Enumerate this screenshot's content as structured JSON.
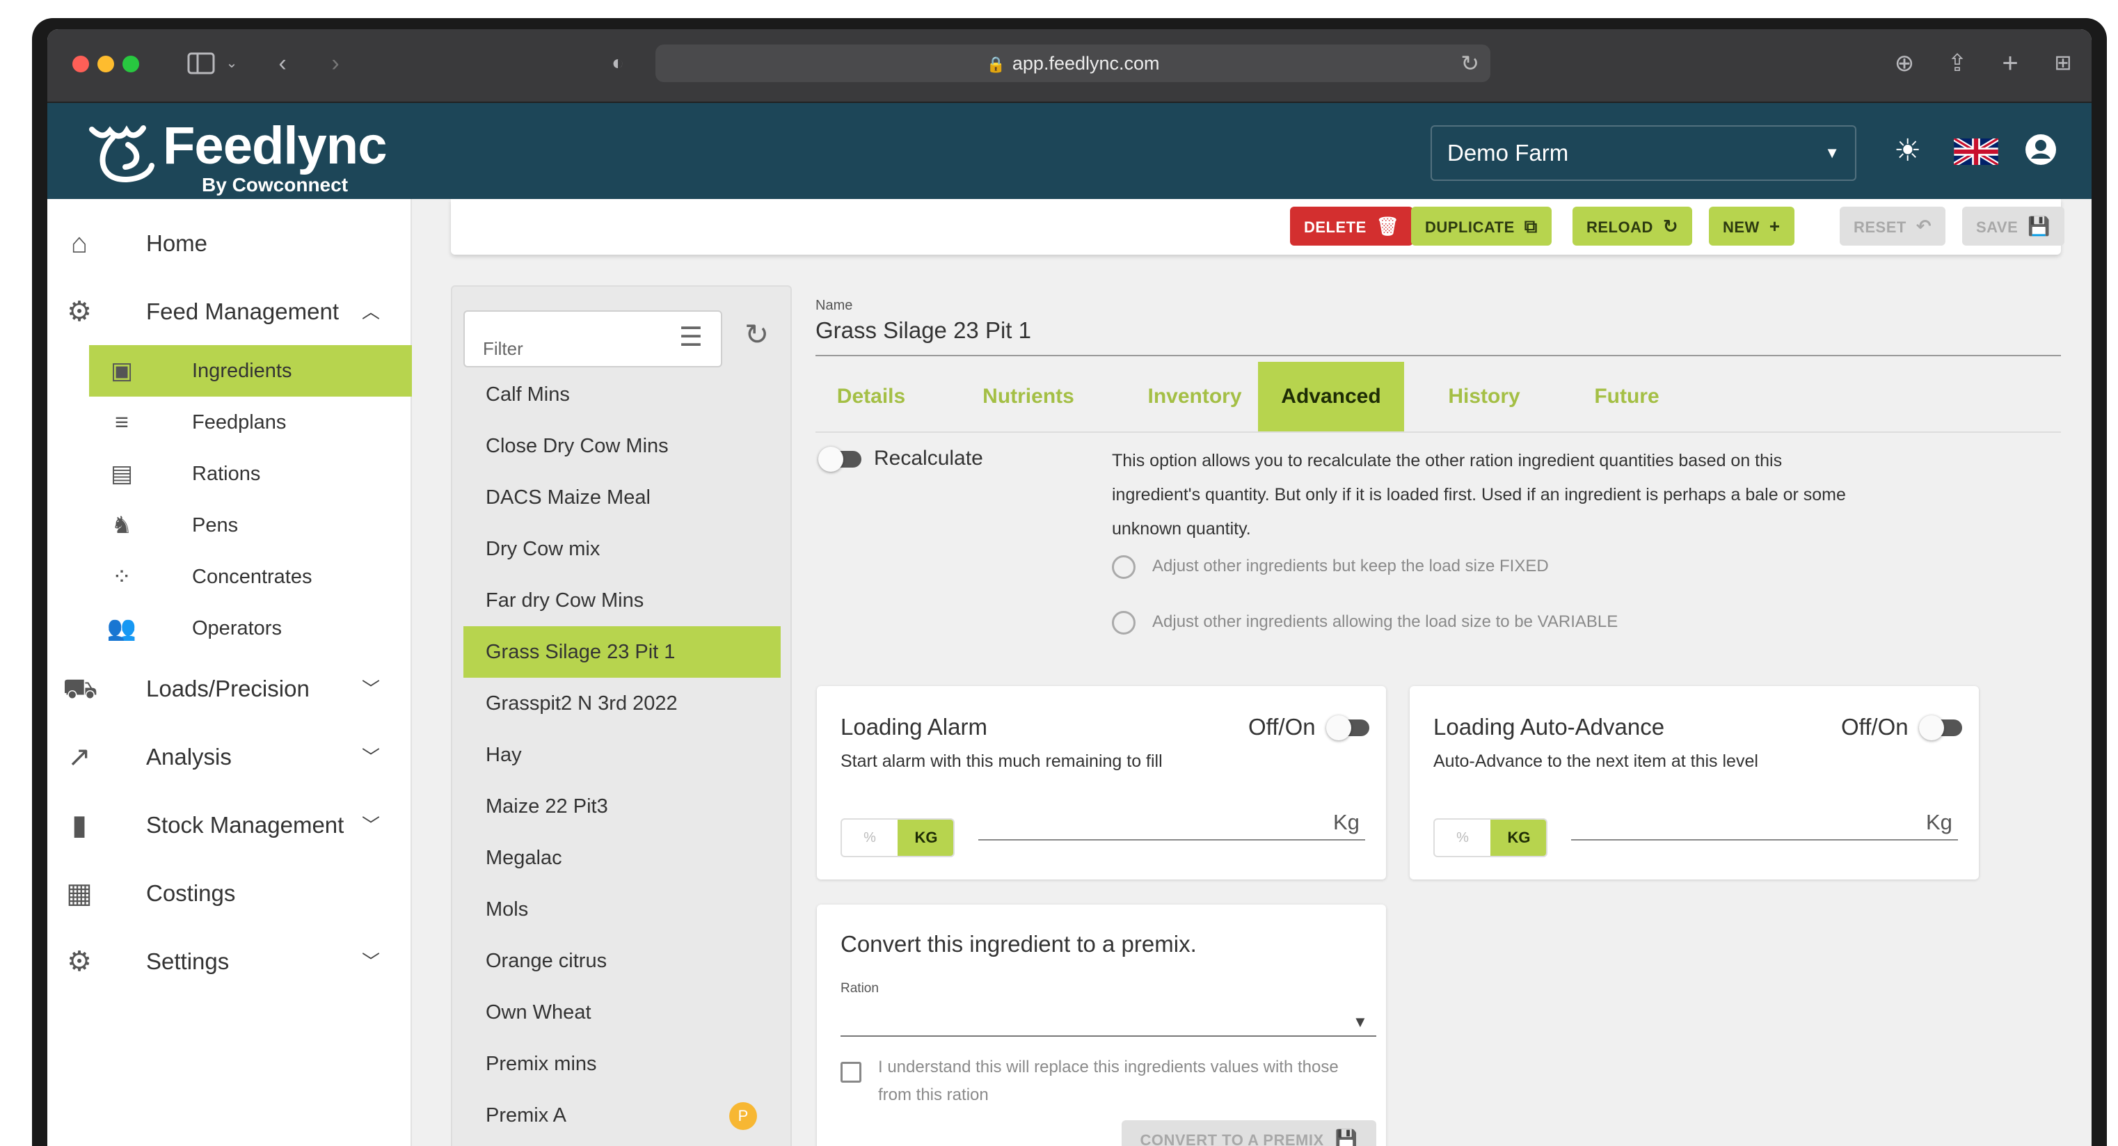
{
  "browser": {
    "url": "app.feedlync.com"
  },
  "app": {
    "brand": "Feedlync",
    "brand_sub": "By Cowconnect",
    "farm": "Demo Farm"
  },
  "sidebar": {
    "home": "Home",
    "feed_management": "Feed Management",
    "sub_items": [
      {
        "label": "Ingredients",
        "icon": "ingredient-icon"
      },
      {
        "label": "Feedplans",
        "icon": "feedplan-icon"
      },
      {
        "label": "Rations",
        "icon": "ration-icon"
      },
      {
        "label": "Pens",
        "icon": "pen-icon"
      },
      {
        "label": "Concentrates",
        "icon": "concentrate-icon"
      },
      {
        "label": "Operators",
        "icon": "operators-icon"
      }
    ],
    "loads": "Loads/Precision",
    "analysis": "Analysis",
    "stock": "Stock Management",
    "costings": "Costings",
    "settings": "Settings"
  },
  "actions": {
    "delete": "DELETE",
    "duplicate": "DUPLICATE",
    "reload": "RELOAD",
    "new": "NEW",
    "reset": "RESET",
    "save": "SAVE"
  },
  "list": {
    "filter_placeholder": "Filter",
    "items": [
      "Calf Mins",
      "Close Dry Cow Mins",
      "DACS Maize Meal",
      "Dry Cow mix",
      "Far dry Cow Mins",
      "Grass Silage 23 Pit 1",
      "Grasspit2 N 3rd 2022",
      "Hay",
      "Maize 22 Pit3",
      "Megalac",
      "Mols",
      "Orange citrus",
      "Own Wheat",
      "Premix mins",
      "Premix A"
    ],
    "selected_index": 5,
    "premix_badge": "P"
  },
  "detail": {
    "name_label": "Name",
    "name_value": "Grass Silage 23 Pit 1",
    "tabs": [
      "Details",
      "Nutrients",
      "Inventory",
      "Advanced",
      "History",
      "Future"
    ],
    "active_tab": "Advanced",
    "recalculate": {
      "label": "Recalculate",
      "description": "This option allows you to recalculate the other ration ingredient quantities based on this ingredient's quantity. But only if it is loaded first. Used if an ingredient is perhaps a bale or some unknown quantity.",
      "option_fixed": "Adjust other ingredients but keep the load size FIXED",
      "option_variable": "Adjust other ingredients allowing the load size to be VARIABLE"
    },
    "loading_alarm": {
      "title": "Loading Alarm",
      "toggle_label": "Off/On",
      "subtitle": "Start alarm with this much remaining to fill",
      "pct": "%",
      "kg": "KG",
      "unit": "Kg"
    },
    "auto_advance": {
      "title": "Loading Auto-Advance",
      "toggle_label": "Off/On",
      "subtitle": "Auto-Advance to the next item at this level",
      "pct": "%",
      "kg": "KG",
      "unit": "Kg"
    },
    "premix": {
      "title": "Convert this ingredient to a premix.",
      "ration_label": "Ration",
      "checkbox_text": "I understand this will replace this ingredients values with those from this ration",
      "button": "CONVERT TO A PREMIX"
    }
  },
  "colors": {
    "accent": "#b7d44e",
    "header": "#1d4658",
    "danger": "#d32f2f"
  }
}
